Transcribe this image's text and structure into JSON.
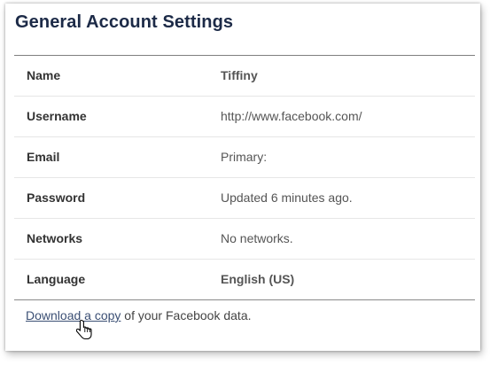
{
  "page": {
    "title": "General Account Settings"
  },
  "settings": {
    "rows": [
      {
        "label": "Name",
        "value": "Tiffiny",
        "bold": true
      },
      {
        "label": "Username",
        "value": "http://www.facebook.com/",
        "bold": false
      },
      {
        "label": "Email",
        "value": "Primary:",
        "bold": false
      },
      {
        "label": "Password",
        "value": "Updated 6 minutes ago.",
        "bold": false
      },
      {
        "label": "Networks",
        "value": "No networks.",
        "bold": false
      },
      {
        "label": "Language",
        "value": "English (US)",
        "bold": true
      }
    ]
  },
  "footer": {
    "link_text": "Download a copy",
    "suffix_text": " of your Facebook data."
  },
  "cursor": {
    "icon": "hand-pointer-icon"
  },
  "colors": {
    "title": "#1c2a47",
    "link": "#3b4f74"
  }
}
